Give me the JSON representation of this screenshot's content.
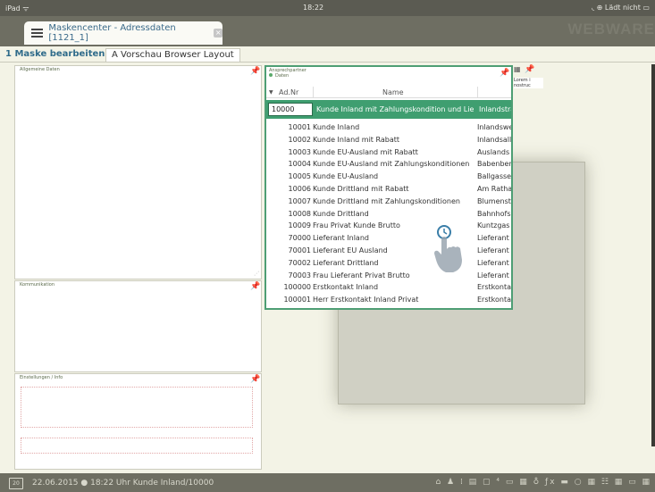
{
  "statusbar": {
    "left": "iPad ᯤ",
    "time": "18:22",
    "right": "◟ ⊕ Lädt nicht ▭"
  },
  "header": {
    "title": "Maskencenter - Adressdaten [1121_1]",
    "close": "×",
    "brand": "WEBWARE"
  },
  "tabs": [
    {
      "label": "1 Maske bearbeiten"
    },
    {
      "label": "A Vorschau Browser Layout"
    }
  ],
  "panels": {
    "allgemein": "Allgemeine Daten",
    "kommunikation": "Kommunikation",
    "einstellungen": "Einstellungen / Info"
  },
  "popup": {
    "title": "Ansprechpartner",
    "subtitle": "Daten",
    "col_nr": "Ad.Nr",
    "col_name": "Name",
    "selected": {
      "nr": "10000",
      "name": "Kunde Inland mit Zahlungskondition und Lie",
      "str": "Inlandstra"
    },
    "rows": [
      {
        "nr": "10001",
        "name": "Kunde Inland",
        "str": "Inlandswe"
      },
      {
        "nr": "10002",
        "name": "Kunde Inland mit Rabatt",
        "str": "Inlandsall"
      },
      {
        "nr": "10003",
        "name": "Kunde EU-Ausland mit Rabatt",
        "str": "Auslands"
      },
      {
        "nr": "10004",
        "name": "Kunde EU-Ausland mit Zahlungskonditionen",
        "str": "Babenber"
      },
      {
        "nr": "10005",
        "name": "Kunde EU-Ausland",
        "str": "Ballgasse"
      },
      {
        "nr": "10006",
        "name": "Kunde Drittland mit Rabatt",
        "str": "Am Ratha"
      },
      {
        "nr": "10007",
        "name": "Kunde Drittland mit Zahlungskonditionen",
        "str": "Blumenst"
      },
      {
        "nr": "10008",
        "name": "Kunde Drittland",
        "str": "Bahnhofs"
      },
      {
        "nr": "10009",
        "name": "Frau Privat Kunde Brutto",
        "str": "Kuntzgas"
      },
      {
        "nr": "70000",
        "name": "Lieferant Inland",
        "str": "Lieferant"
      },
      {
        "nr": "70001",
        "name": "Lieferant EU Ausland",
        "str": "Lieferant"
      },
      {
        "nr": "70002",
        "name": "Lieferant Drittland",
        "str": "Lieferant"
      },
      {
        "nr": "70003",
        "name": "Frau Lieferant Privat Brutto",
        "str": "Lieferant"
      },
      {
        "nr": "100000",
        "name": "Erstkontakt Inland",
        "str": "Erstkonta"
      },
      {
        "nr": "100001",
        "name": "Herr Erstkontakt Inland Privat",
        "str": "Erstkonta"
      }
    ]
  },
  "mini": {
    "text1": "Lorem i",
    "text2": "nostruc"
  },
  "footer": {
    "cal": "20",
    "text": "22.06.2015 ● 18:22 Uhr   Kunde Inland/10000",
    "icons": "⌂ ♟ ⁞ ▤ ▢ ⁴ ▭ ▦ ♁ ƒx ▬ ○ ▦ ☷ ▦ ▭ ▦"
  }
}
